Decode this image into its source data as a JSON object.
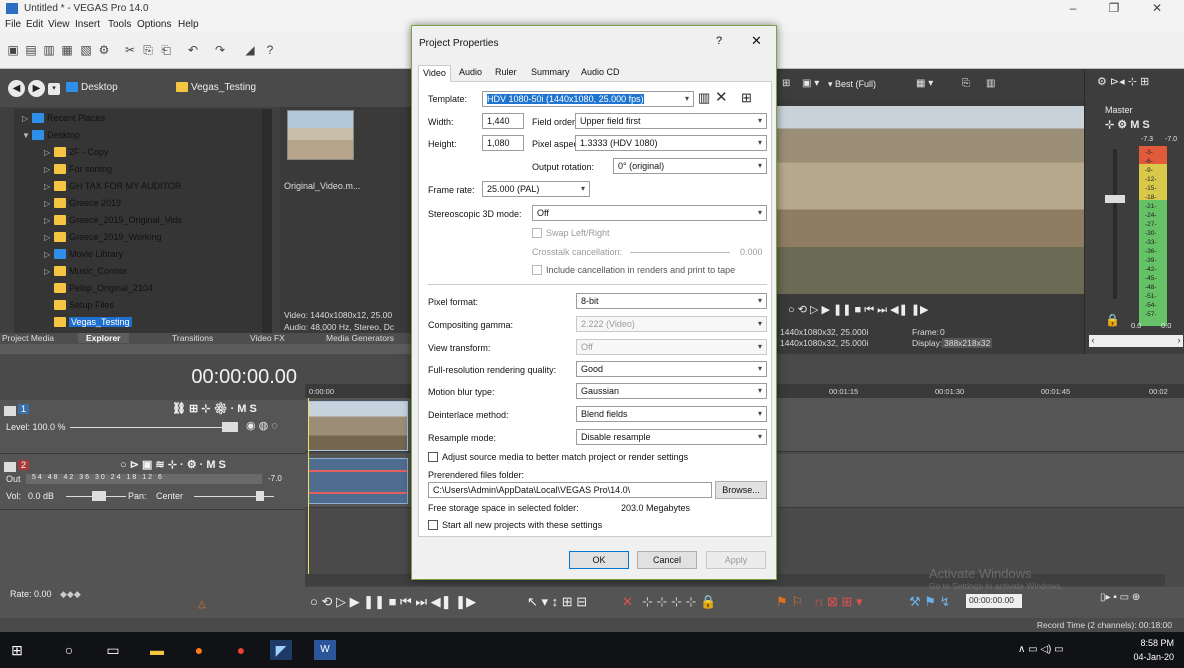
{
  "window": {
    "title": "Untitled * - VEGAS Pro 14.0",
    "controls": [
      "–",
      "❐",
      "✕"
    ]
  },
  "menu": [
    "File",
    "Edit",
    "View",
    "Insert",
    "Tools",
    "Options",
    "Help"
  ],
  "explorer": {
    "breadcrumb": [
      "Desktop",
      "Vegas_Testing"
    ],
    "tree": [
      {
        "label": "Recent Places",
        "icon": "recent"
      },
      {
        "label": "Desktop",
        "icon": "desktop"
      },
      {
        "label": "2F - Copy",
        "icon": "folder"
      },
      {
        "label": "For sorting",
        "icon": "folder"
      },
      {
        "label": "GH TAX FOR MY AUDITOR",
        "icon": "folder"
      },
      {
        "label": "Greece 2019",
        "icon": "folder"
      },
      {
        "label": "Greece_2019_Original_Vids",
        "icon": "folder"
      },
      {
        "label": "Greece_2019_Working",
        "icon": "folder"
      },
      {
        "label": "Movie Library",
        "icon": "library"
      },
      {
        "label": "Music_Connor",
        "icon": "folder"
      },
      {
        "label": "Pelop_Original_2104",
        "icon": "folder"
      },
      {
        "label": "Setup Files",
        "icon": "folder"
      },
      {
        "label": "Vegas_Testing",
        "icon": "folder",
        "selected": true
      }
    ],
    "file_name": "Original_Video.m...",
    "media_info": [
      "Video: 1440x1080x12, 25.00",
      "Audio: 48,000 Hz, Stereo, Dc"
    ],
    "tabs": [
      "Project Media",
      "Explorer",
      "Transitions",
      "Video FX",
      "Media Generators"
    ]
  },
  "preview": {
    "quality": "Best (Full)",
    "project_info": "1440x1080x32, 25.000i",
    "preview_info": "1440x1080x32, 25.000i",
    "frame_label": "Frame:",
    "frame_value": "0",
    "display_label": "Display:",
    "display_value": "388x218x32"
  },
  "master": {
    "label": "Master",
    "db_left": "-7.3",
    "db_right": "-7.0",
    "scale": [
      "3",
      "6",
      "9",
      "12",
      "15",
      "18",
      "21",
      "24",
      "27",
      "30",
      "33",
      "36",
      "39",
      "42",
      "45",
      "48",
      "51",
      "54",
      "57"
    ],
    "bottom_left": "0.0",
    "bottom_right": "0.0"
  },
  "timeline": {
    "timecode": "00:00:00.00",
    "ruler": [
      "0:00:00",
      "00:01:15",
      "00:01:30",
      "00:01:45",
      "00:02"
    ],
    "track1": {
      "number": "1",
      "level": "Level: 100.0 %"
    },
    "track2": {
      "number": "2",
      "out_label": "Out",
      "out_scale": [
        "54",
        "48",
        "42",
        "36",
        "30",
        "24",
        "18",
        "12",
        "6"
      ],
      "out_value": "-7.0",
      "vol_label": "Vol:",
      "vol_value": "0.0 dB",
      "pan_label": "Pan:",
      "pan_value": "Center"
    },
    "rate": "Rate: 0.00",
    "bottom_time": "00:00:00.00",
    "record_time": "Record Time (2 channels): 00:18:00"
  },
  "watermark": {
    "line1": "Activate Windows",
    "line2": "Go to Settings to activate Windows."
  },
  "taskbar": {
    "time": "8:58 PM",
    "date": "04-Jan-20"
  },
  "dialog": {
    "title": "Project Properties",
    "help": "?",
    "close": "✕",
    "tabs": [
      "Video",
      "Audio",
      "Ruler",
      "Summary",
      "Audio CD"
    ],
    "template_label": "Template:",
    "template_value": "HDV 1080-50i (1440x1080, 25.000 fps)",
    "width_label": "Width:",
    "width_value": "1,440",
    "height_label": "Height:",
    "height_value": "1,080",
    "field_order_label": "Field order:",
    "field_order_value": "Upper field first",
    "par_label": "Pixel aspect ratio:",
    "par_value": "1.3333 (HDV 1080)",
    "rotation_label": "Output rotation:",
    "rotation_value": "0° (original)",
    "frame_rate_label": "Frame rate:",
    "frame_rate_value": "25.000 (PAL)",
    "stereo_label": "Stereoscopic 3D mode:",
    "stereo_value": "Off",
    "swap_label": "Swap Left/Right",
    "crosstalk_label": "Crosstalk cancellation:",
    "crosstalk_value": "0.000",
    "include_cancel_label": "Include cancellation in renders and print to tape",
    "pixel_format_label": "Pixel format:",
    "pixel_format_value": "8-bit",
    "gamma_label": "Compositing gamma:",
    "gamma_value": "2.222 (Video)",
    "view_transform_label": "View transform:",
    "view_transform_value": "Off",
    "fullres_label": "Full-resolution rendering quality:",
    "fullres_value": "Good",
    "motion_blur_label": "Motion blur type:",
    "motion_blur_value": "Gaussian",
    "deinterlace_label": "Deinterlace method:",
    "deinterlace_value": "Blend fields",
    "resample_label": "Resample mode:",
    "resample_value": "Disable resample",
    "adjust_label": "Adjust source media to better match project or render settings",
    "prerendered_label": "Prerendered files folder:",
    "prerendered_value": "C:\\Users\\Admin\\AppData\\Local\\VEGAS Pro\\14.0\\",
    "browse_label": "Browse...",
    "free_storage_label": "Free storage space in selected folder:",
    "free_storage_value": "203.0 Megabytes",
    "start_all_label": "Start all new projects with these settings",
    "ok_label": "OK",
    "cancel_label": "Cancel",
    "apply_label": "Apply"
  }
}
